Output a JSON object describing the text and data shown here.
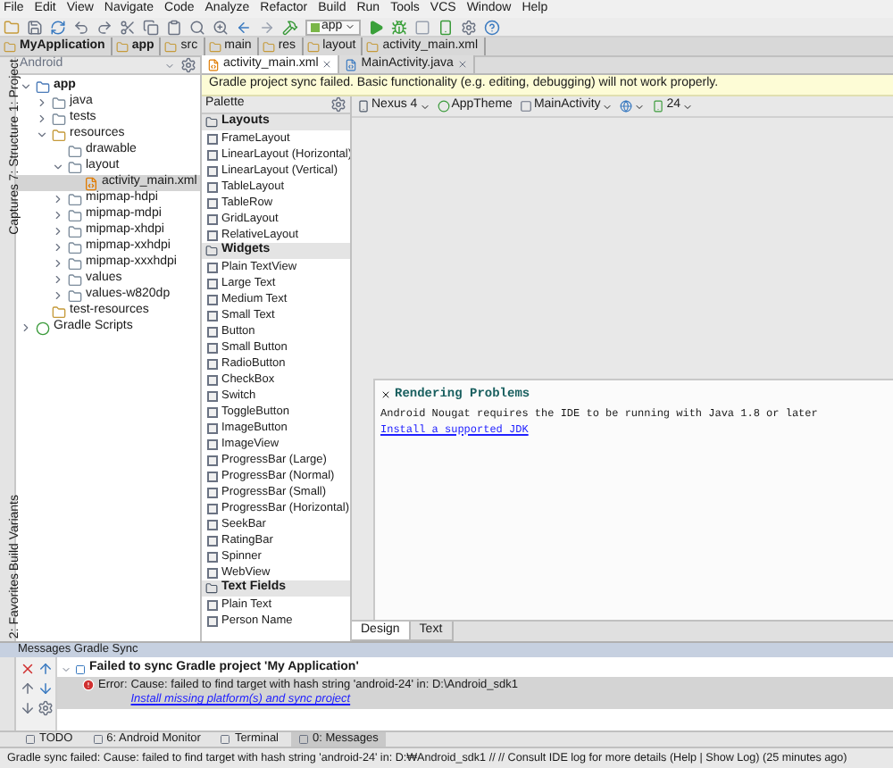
{
  "menu": [
    "File",
    "Edit",
    "View",
    "Navigate",
    "Code",
    "Analyze",
    "Refactor",
    "Build",
    "Run",
    "Tools",
    "VCS",
    "Window",
    "Help"
  ],
  "toolbar": {
    "run_config": "app"
  },
  "breadcrumb": [
    "MyApplication",
    "app",
    "src",
    "main",
    "res",
    "layout",
    "activity_main.xml"
  ],
  "side_tabs_top": [
    "1: Project",
    "7: Structure",
    "Captures"
  ],
  "side_tabs_bottom": [
    "Build Variants",
    "2: Favorites"
  ],
  "project": {
    "view": "Android",
    "tree": [
      {
        "label": "app",
        "kind": "module",
        "expanded": true,
        "selected": false,
        "children": [
          {
            "label": "java",
            "kind": "folder",
            "expanded": false,
            "selected": false
          },
          {
            "label": "tests",
            "kind": "folder",
            "expanded": false,
            "selected": false
          },
          {
            "label": "resources",
            "kind": "res",
            "expanded": true,
            "selected": false,
            "children": [
              {
                "label": "drawable",
                "kind": "folder",
                "selected": false
              },
              {
                "label": "layout",
                "kind": "folder",
                "expanded": true,
                "selected": false,
                "children": [
                  {
                    "label": "activity_main.xml",
                    "kind": "xml",
                    "selected": true
                  }
                ]
              },
              {
                "label": "mipmap-hdpi",
                "kind": "folder",
                "expanded": false,
                "selected": false
              },
              {
                "label": "mipmap-mdpi",
                "kind": "folder",
                "expanded": false,
                "selected": false
              },
              {
                "label": "mipmap-xhdpi",
                "kind": "folder",
                "expanded": false,
                "selected": false
              },
              {
                "label": "mipmap-xxhdpi",
                "kind": "folder",
                "expanded": false,
                "selected": false
              },
              {
                "label": "mipmap-xxxhdpi",
                "kind": "folder",
                "expanded": false,
                "selected": false
              },
              {
                "label": "values",
                "kind": "folder",
                "expanded": false,
                "selected": false
              },
              {
                "label": "values-w820dp",
                "kind": "folder",
                "expanded": false,
                "selected": false
              }
            ]
          },
          {
            "label": "test-resources",
            "kind": "res",
            "selected": false
          }
        ]
      },
      {
        "label": "Gradle Scripts",
        "kind": "gradle",
        "expanded": false,
        "selected": false
      }
    ]
  },
  "editor_tabs": [
    {
      "label": "activity_main.xml",
      "selected": true
    },
    {
      "label": "MainActivity.java",
      "selected": false
    }
  ],
  "banner": "Gradle project sync failed. Basic functionality (e.g. editing, debugging) will not work properly.",
  "palette": {
    "title": "Palette",
    "sections": [
      {
        "title": "Layouts",
        "items": [
          "FrameLayout",
          "LinearLayout (Horizontal)",
          "LinearLayout (Vertical)",
          "TableLayout",
          "TableRow",
          "GridLayout",
          "RelativeLayout"
        ]
      },
      {
        "title": "Widgets",
        "items": [
          "Plain TextView",
          "Large Text",
          "Medium Text",
          "Small Text",
          "Button",
          "Small Button",
          "RadioButton",
          "CheckBox",
          "Switch",
          "ToggleButton",
          "ImageButton",
          "ImageView",
          "ProgressBar (Large)",
          "ProgressBar (Normal)",
          "ProgressBar (Small)",
          "ProgressBar (Horizontal)",
          "SeekBar",
          "RatingBar",
          "Spinner",
          "WebView"
        ]
      },
      {
        "title": "Text Fields",
        "items": [
          "Plain Text",
          "Person Name"
        ]
      }
    ]
  },
  "design_toolbar": {
    "device": "Nexus 4",
    "theme": "AppTheme",
    "activity": "MainActivity",
    "api": "24"
  },
  "rendering": {
    "title": "Rendering Problems",
    "message": "Android Nougat requires the IDE to be running with Java 1.8 or later",
    "link": "Install a supported JDK"
  },
  "design_tabs": [
    {
      "label": "Design",
      "selected": true
    },
    {
      "label": "Text",
      "selected": false
    }
  ],
  "messages": {
    "title": "Messages Gradle Sync",
    "root": "Failed to sync Gradle project 'My Application'",
    "expanded": true,
    "error_label": "Error:",
    "error": "Cause: failed to find target with hash string 'android-24' in: D:\\Android_sdk1",
    "link": "Install missing platform(s) and sync project"
  },
  "bottom_tabs": [
    {
      "label": "TODO",
      "selected": false
    },
    {
      "label": "6: Android Monitor",
      "selected": false
    },
    {
      "label": "Terminal",
      "selected": false
    },
    {
      "label": "0: Messages",
      "selected": true
    }
  ],
  "status": "Gradle sync failed: Cause: failed to find target with hash string 'android-24' in: D:₩Android_sdk1 // // Consult IDE log for more details (Help | Show Log) (25 minutes ago)"
}
